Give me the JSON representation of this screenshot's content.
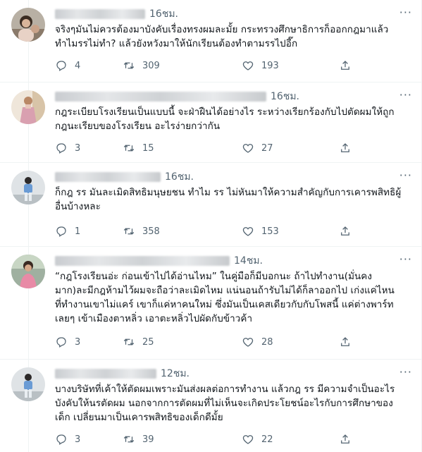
{
  "tweets": [
    {
      "time": "16ชม.",
      "text": "จริงๆมันไม่ควรต้องมาบังคับเรื่องทรงผมละมั้ย กระทรวงศึกษาธิการก็ออกกฎมาแล้ว\nทำไมรรไม่ทำ? แล้วยังหวังมาให้นักเรียนต้องทำตามรรไปอี๊ก",
      "replies": "4",
      "retweets": "309",
      "likes": "193"
    },
    {
      "time": "16ชม.",
      "text": "กฎระเบียบโรงเรียนเป็นแบบนี้ จะฝ่าฝืนได้อย่างไร ระหว่างเรียกร้องกับไปตัดผมให้ถูก\nกฎนะเรียบของโรงเรียน อะไรง่ายกว่ากัน",
      "replies": "3",
      "retweets": "15",
      "likes": "27"
    },
    {
      "time": "16ชม.",
      "text": "ก็กฎ รร มันละเมิดสิทธิมนุษยชน ทำไม รร ไม่หันมาให้ความสำคัญกับการเคารพสิทธิผู้\nอื่นบ้างหละ",
      "replies": "1",
      "retweets": "358",
      "likes": "153"
    },
    {
      "time": "14ชม.",
      "text": "“กฎโรงเรียนอ่ะ ก่อนเข้าไปได้อ่านไหม” ในคู่มือก็มีบอกนะ ถ้าไปทำงาน(มั่นคง\nมาก)ละมีกฎห้ามไว้ผมจะถือว่าละเมิดไหม แน่นอนถ้ารับไม่ได้ก็ลาออกไป เก่งแค่ไหน\nที่ทำงานเขาไม่แคร์ เขาก็แค่หาคนใหม่ ซึ่งมันเป็นเคสเดียวกับกับโพสนี้ แค่ต่างพาร์ท\nเลยๆ เข้าเมืองตาหลิ่ว เอาตะหลิ่วไปผัดกับข้าวค้า",
      "replies": "3",
      "retweets": "25",
      "likes": "28"
    },
    {
      "time": "12ชม.",
      "text": "บางบริษัทที่เค้าให้ตัดผมเพราะมันส่งผลต่อการทำงาน แล้วกฎ รร มีความจำเป็นอะไร\nบังคับให้นรตัดผม นอกจากการตัดผมที่ไม่เห็นจะเกิดประโยชน์อะไรกับการศึกษาของ\nเด็ก เปลี่ยนมาเป็นเคารพสิทธิของเด็กดีมั้ย",
      "replies": "3",
      "retweets": "39",
      "likes": "22"
    }
  ],
  "icons": {
    "reply": "reply-icon",
    "retweet": "retweet-icon",
    "like": "heart-icon",
    "share": "share-icon",
    "more": "more-icon"
  },
  "colors": {
    "secondary_text": "#536471",
    "divider": "#eff3f4"
  }
}
